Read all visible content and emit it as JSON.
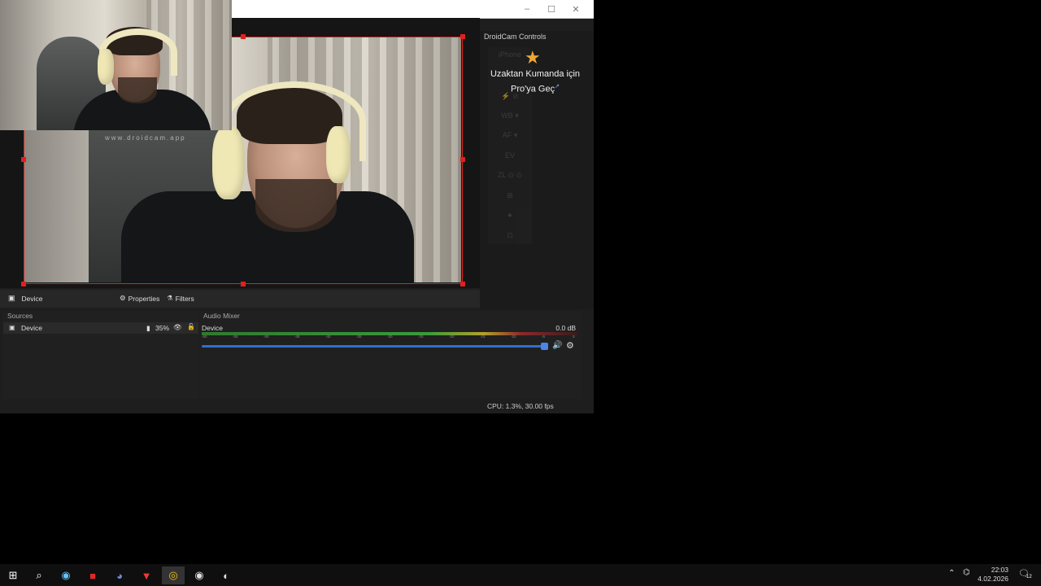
{
  "obs": {
    "window_controls": [
      "–",
      "☐",
      "✕"
    ],
    "dock_title": "DroidCam Controls",
    "dock_tools": [
      "iPhone",
      "⚡ ⊘",
      "WB ▾",
      "AF ▾",
      "EV",
      "ZL ⊙ ⊙",
      "⊞",
      "●",
      "⊡"
    ],
    "pro_line1": "Uzaktan Kumanda için",
    "pro_line2": "Pro'ya Geç",
    "pro_sup": "↗",
    "watermark": "www.droidcam.app",
    "source_bar": {
      "source_name": "Device",
      "properties_label": "Properties",
      "filters_label": "Filters"
    },
    "sources": {
      "title": "Sources",
      "item_name": "Device",
      "item_volume": "35%"
    },
    "mixer": {
      "title": "Audio Mixer",
      "channel_name": "Device",
      "db_value": "0.0 dB",
      "ticks": [
        "-60",
        "-55",
        "-50",
        "-45",
        "-40",
        "-35",
        "-30",
        "-25",
        "-20",
        "-15",
        "-10",
        "-5",
        "0"
      ]
    },
    "status": "CPU: 1.3%, 30.00 fps"
  },
  "taskbar": {
    "time": "22:03",
    "date": "4.02.2026",
    "notification_count": "12",
    "icons": [
      "windows-start-icon",
      "search-icon",
      "steam-icon",
      "app-red-icon",
      "discord-icon",
      "app-vivaldi-icon",
      "chrome-icon",
      "droidcam-icon",
      "obs-icon"
    ]
  },
  "colors": {
    "selection": "#e02020",
    "accent": "#2f6fd1",
    "star": "#f0a733"
  }
}
